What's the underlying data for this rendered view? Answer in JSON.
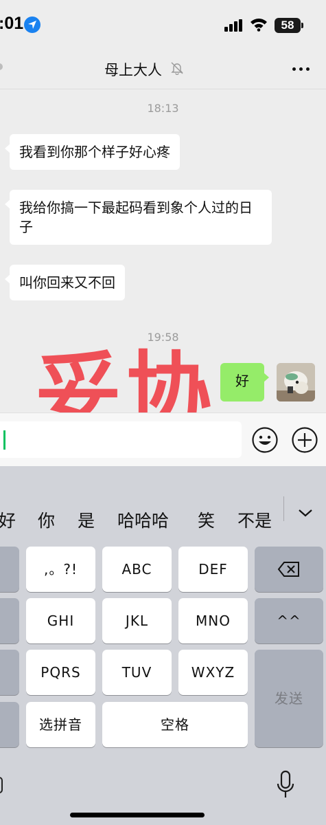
{
  "status_bar": {
    "time": ":01",
    "battery": "58",
    "icons": [
      "location-arrow-icon",
      "cellular-signal-icon",
      "wifi-icon",
      "battery-icon"
    ]
  },
  "nav": {
    "title": "母上大人",
    "icons": [
      "mute-bell-icon",
      "more-dots-icon"
    ]
  },
  "messages": [
    {
      "type": "time",
      "text": "18:13"
    },
    {
      "type": "incoming",
      "text": "我看到你那个样子好心疼"
    },
    {
      "type": "incoming",
      "text": "我给你搞一下最起码看到象个人过的日子"
    },
    {
      "type": "incoming",
      "text": "叫你回来又不回"
    },
    {
      "type": "time",
      "text": "19:58"
    },
    {
      "type": "outgoing",
      "text": "好"
    }
  ],
  "overlay_text": "妥协",
  "input": {
    "value": "",
    "icons": [
      "emoji-icon",
      "plus-icon"
    ]
  },
  "keyboard": {
    "candidates": [
      "好",
      "你",
      "是",
      "哈哈哈",
      "笑",
      "不是"
    ],
    "keys": {
      "punct": ",。?!",
      "abc": "ABC",
      "def": "DEF",
      "ghi": "GHI",
      "jkl": "JKL",
      "mno": "MNO",
      "pqrs": "PQRS",
      "tuv": "TUV",
      "wxyz": "WXYZ",
      "face": "^^",
      "pinyin": "选拼音",
      "space": "空格",
      "send": "发送"
    },
    "icons": [
      "backspace-icon",
      "chevron-down-icon",
      "microphone-icon"
    ]
  },
  "colors": {
    "outgoing_bubble": "#95ec69",
    "overlay": "#ef3a42",
    "caret": "#07c160",
    "location": "#1a82f0"
  }
}
